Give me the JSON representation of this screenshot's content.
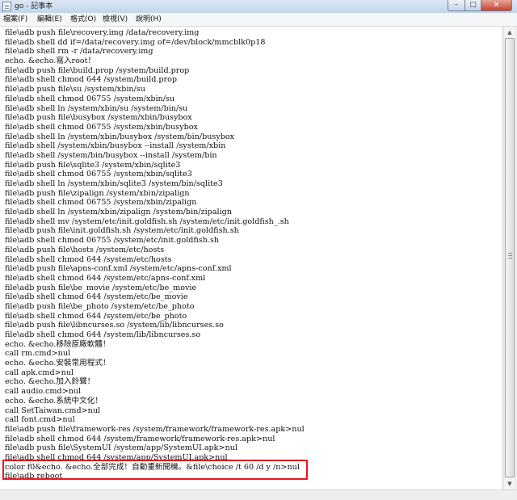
{
  "window": {
    "title": "go - 記事本"
  },
  "title_buttons": {
    "minimize": "–",
    "maximize": "□",
    "close": "×"
  },
  "menu": [
    "檔案(F)",
    "編輯(E)",
    "格式(O)",
    "檢視(V)",
    "說明(H)"
  ],
  "lines": [
    "file\\adb push file\\recovery.img /data/recovery.img",
    "file\\adb shell dd if=/data/recovery.img of=/dev/block/mmcblk0p18",
    "file\\adb shell rm -r /data/recovery.img",
    "echo. &echo.寫入root！",
    "file\\adb push file\\build.prop /system/build.prop",
    "file\\adb shell chmod 644 /system/build.prop",
    "file\\adb push file\\su /system/xbin/su",
    "file\\adb shell chmod 06755 /system/xbin/su",
    "file\\adb shell ln /system/xbin/su /system/bin/su",
    "file\\adb push file\\busybox /system/xbin/busybox",
    "file\\adb shell chmod 06755 /system/xbin/busybox",
    "file\\adb shell ln /system/xbin/busybox /system/bin/busybox",
    "file\\adb shell /system/xbin/busybox --install /system/xbin",
    "file\\adb shell /system/bin/busybox --install /system/bin",
    "file\\adb push file\\sqlite3 /system/xbin/sqlite3",
    "file\\adb shell chmod 06755 /system/xbin/sqlite3",
    "file\\adb shell ln /system/xbin/sqlite3 /system/bin/sqlite3",
    "file\\adb push file\\zipalign /system/xbin/zipalign",
    "file\\adb shell chmod 06755 /system/xbin/zipalign",
    "file\\adb shell ln /system/xbin/zipalign /system/bin/zipalign",
    "file\\adb shell mv /system/etc/init.goldfish.sh /system/etc/init.goldfish_.sh",
    "file\\adb push file\\init.goldfish.sh /system/etc/init.goldfish.sh",
    "file\\adb shell chmod 06755 /system/etc/init.goldfish.sh",
    "file\\adb push file\\hosts /system/etc/hosts",
    "file\\adb shell chmod 644 /system/etc/hosts",
    "file\\adb push file\\apns-conf.xml /system/etc/apns-conf.xml",
    "file\\adb shell chmod 644 /system/etc/apns-conf.xml",
    "file\\adb push file\\be_movie /system/etc/be_movie",
    "file\\adb shell chmod 644 /system/etc/be_movie",
    "file\\adb push file\\be_photo /system/etc/be_photo",
    "file\\adb shell chmod 644 /system/etc/be_photo",
    "file\\adb push file\\libncurses.so /system/lib/libncurses.so",
    "file\\adb shell chmod 644 /system/lib/libncurses.so",
    "echo. &echo.移除原廠軟體！",
    "call rm.cmd>nul",
    "echo. &echo.安裝常用程式！",
    "call apk.cmd>nul",
    "echo. &echo.加入鈴聲！",
    "call audio.cmd>nul",
    "echo. &echo.系統中文化！",
    "call SetTaiwan.cmd>nul",
    "call font.cmd>nul",
    "file\\adb push file\\framework-res /system/framework/framework-res.apk>nul",
    "file\\adb shell chmod 644 /system/framework/framework-res.apk>nul",
    "file\\adb push file\\SystemUI /system/app/SystemUI.apk>nul",
    "file\\adb shell chmod 644 /system/app/SystemUI.apk>nul",
    "color f0&echo. &echo.全部完成！自動重新開機。&file\\choice /t 60 /d y /n>nul",
    "file\\adb reboot"
  ],
  "scrollbar": {
    "up_arrow": "▲",
    "down_arrow": "▼"
  }
}
